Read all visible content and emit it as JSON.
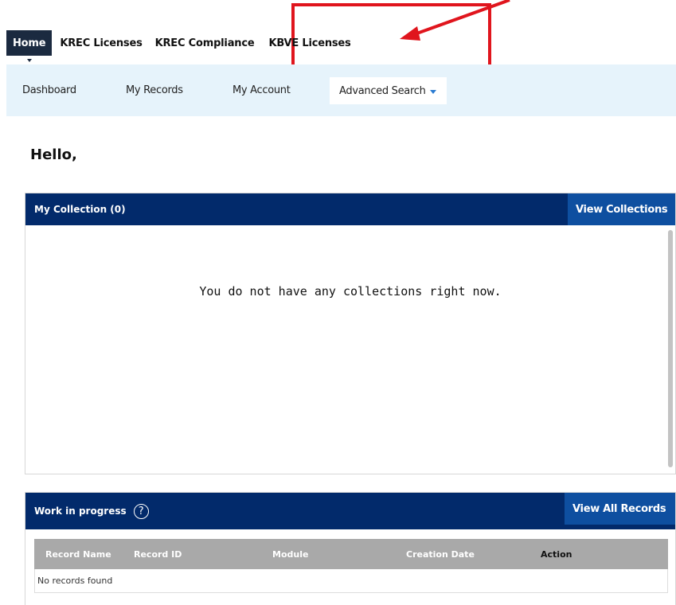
{
  "top_tabs": [
    {
      "label": "Home",
      "active": true
    },
    {
      "label": "KREC Licenses",
      "active": false
    },
    {
      "label": "KREC Compliance",
      "active": false
    },
    {
      "label": "KBVE Licenses",
      "active": false
    }
  ],
  "sub_nav": {
    "dashboard": "Dashboard",
    "my_records": "My Records",
    "my_account": "My Account",
    "advanced_search": "Advanced Search"
  },
  "greeting": "Hello,",
  "collection_panel": {
    "title": "My Collection (0)",
    "button": "View Collections",
    "empty_message": "You do not have any collections right now."
  },
  "wip_panel": {
    "title": "Work in progress",
    "help_symbol": "?",
    "button": "View All Records",
    "columns": [
      "Record Name",
      "Record ID",
      "Module",
      "Creation Date",
      "Action"
    ],
    "empty_row": "No records found"
  },
  "annotation": {
    "color": "#e0151d",
    "target": "KBVE Licenses"
  },
  "colors": {
    "header_navy": "#022a6b",
    "button_blue": "#0e4fa0",
    "subnav_bg": "#e6f3fb",
    "active_tab": "#1b2a40"
  }
}
